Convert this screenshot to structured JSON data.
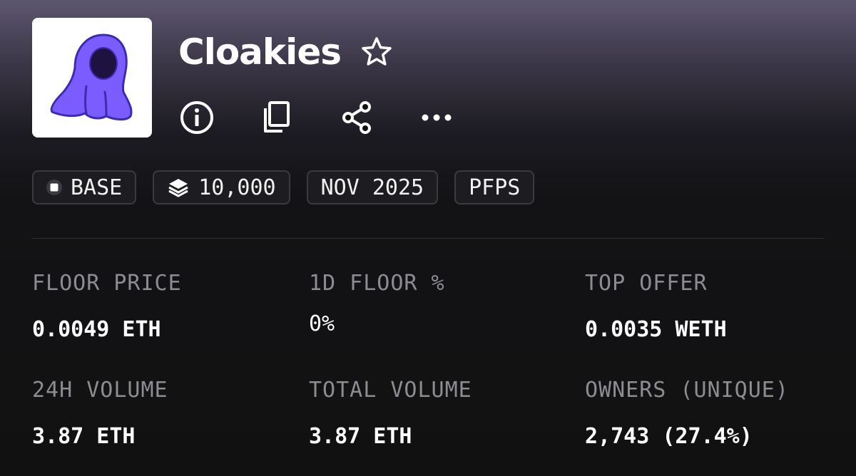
{
  "collection": {
    "name": "Cloakies",
    "logo_icon": "hooded-cloak-icon",
    "favorite_icon": "star-outline-icon"
  },
  "actions": [
    {
      "icon": "info-icon"
    },
    {
      "icon": "copy-icon"
    },
    {
      "icon": "share-icon"
    },
    {
      "icon": "more-icon"
    }
  ],
  "tags": {
    "chain": "BASE",
    "supply": "10,000",
    "date": "NOV 2025",
    "category": "PFPS"
  },
  "stats": {
    "floor_price": {
      "label": "FLOOR PRICE",
      "value": "0.0049 ETH"
    },
    "floor_change_1d": {
      "label": "1D FLOOR %",
      "value": "0%"
    },
    "top_offer": {
      "label": "TOP OFFER",
      "value": "0.0035 WETH"
    },
    "volume_24h": {
      "label": "24H VOLUME",
      "value": "3.87 ETH"
    },
    "total_volume": {
      "label": "TOTAL VOLUME",
      "value": "3.87 ETH"
    },
    "owners": {
      "label": "OWNERS (UNIQUE)",
      "value": "2,743 (27.4%)"
    }
  },
  "colors": {
    "background": "#111112",
    "accent_purple": "#7b5cff",
    "label_gray": "#8c8c92",
    "tag_border": "#3a3a3f"
  }
}
